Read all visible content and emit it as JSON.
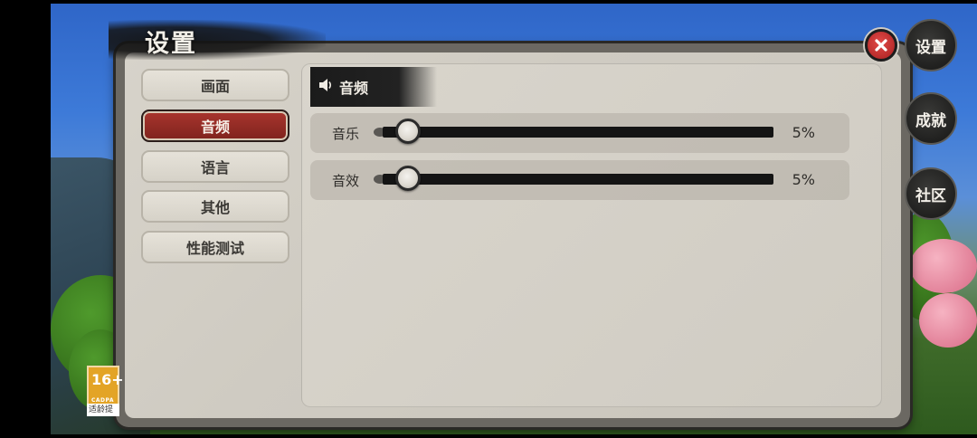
{
  "title": "设置",
  "tabs": [
    {
      "label": "画面",
      "active": false
    },
    {
      "label": "音频",
      "active": true
    },
    {
      "label": "语言",
      "active": false
    },
    {
      "label": "其他",
      "active": false
    },
    {
      "label": "性能测试",
      "active": false
    }
  ],
  "section": {
    "icon": "speaker-icon",
    "title": "音频"
  },
  "sliders": [
    {
      "label": "音乐",
      "value": 5,
      "value_text": "5%"
    },
    {
      "label": "音效",
      "value": 5,
      "value_text": "5%"
    }
  ],
  "side_buttons": [
    {
      "label": "设置"
    },
    {
      "label": "成就"
    },
    {
      "label": "社区"
    }
  ],
  "age_rating": {
    "number": "16+",
    "org": "CADPA",
    "caption": "适龄提示"
  },
  "colors": {
    "active_tab": "#a9352e",
    "close": "#d63b3b",
    "panel": "#d3cfc6"
  }
}
